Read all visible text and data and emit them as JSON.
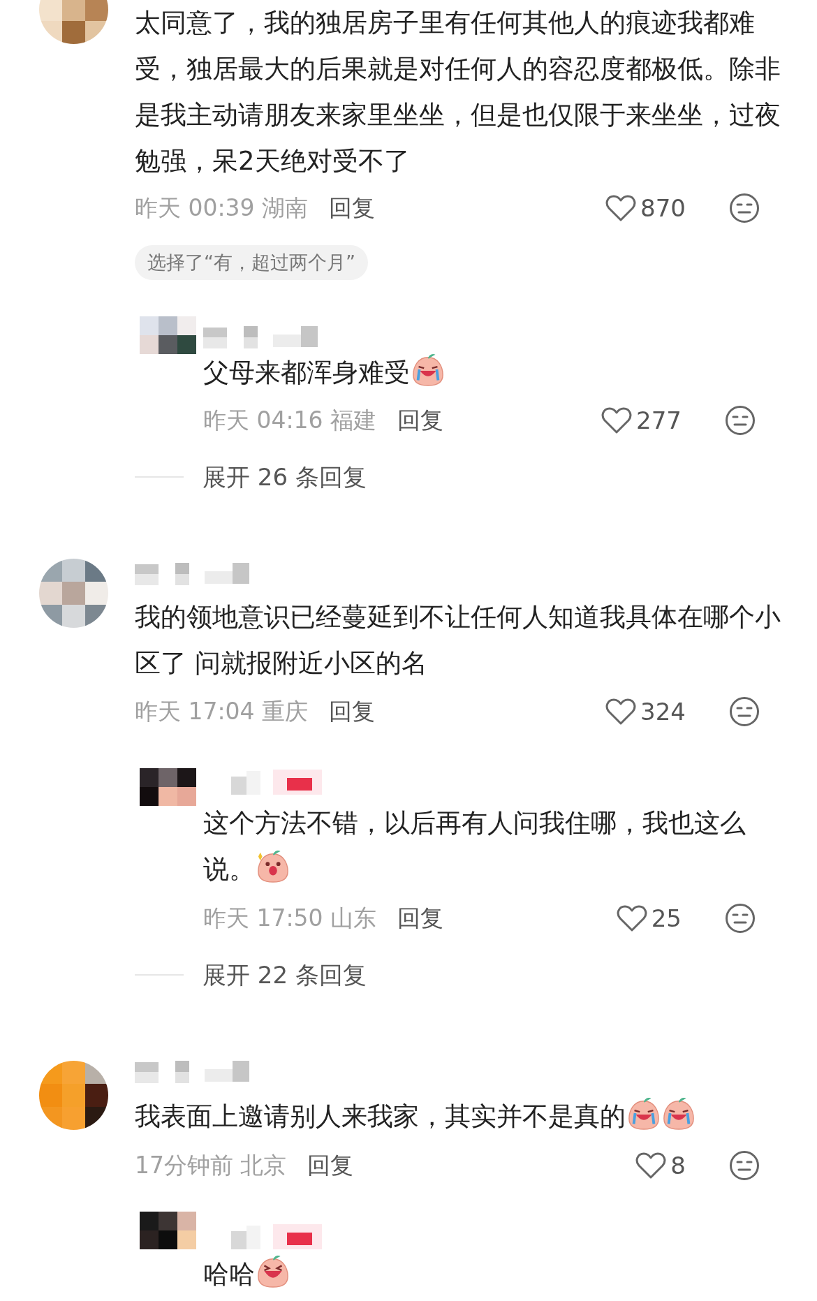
{
  "comments": [
    {
      "text": "太同意了，我的独居房子里有任何其他人的痕迹我都难受，独居最大的后果就是对任何人的容忍度都极低。除非是我主动请朋友来家里坐坐，但是也仅限于来坐坐，过夜勉强，呆2天绝对受不了",
      "meta": "昨天 00:39 湖南",
      "reply_label": "回复",
      "likes": "870",
      "vote_tag": "选择了“有，超过两个月”",
      "replies": [
        {
          "text": "父母来都浑身难受",
          "stickers": [
            {
              "kind": "crying"
            }
          ],
          "meta": "昨天 04:16 福建",
          "reply_label": "回复",
          "likes": "277"
        }
      ],
      "expand_label": "展开 26 条回复"
    },
    {
      "text": "我的领地意识已经蔓延到不让任何人知道我具体在哪个小区了 问就报附近小区的名",
      "meta": "昨天 17:04 重庆",
      "reply_label": "回复",
      "likes": "324",
      "replies": [
        {
          "text": "这个方法不错，以后再有人问我住哪，我也这么说。",
          "stickers": [
            {
              "kind": "shouting"
            }
          ],
          "meta": "昨天 17:50 山东",
          "reply_label": "回复",
          "likes": "25"
        }
      ],
      "expand_label": "展开 22 条回复"
    },
    {
      "text": "我表面上邀请别人来我家，其实并不是真的",
      "stickers": [
        {
          "kind": "crying"
        },
        {
          "kind": "crying"
        }
      ],
      "meta": "17分钟前 北京",
      "reply_label": "回复",
      "likes": "8",
      "replies": [
        {
          "text": "哈哈",
          "stickers": [
            {
              "kind": "laughing"
            }
          ]
        }
      ]
    }
  ]
}
